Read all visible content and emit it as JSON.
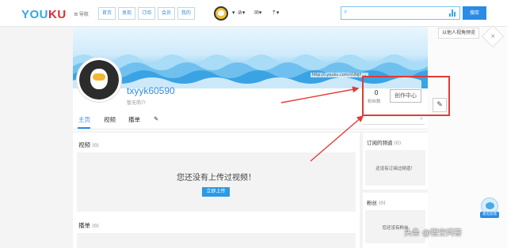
{
  "header": {
    "logo_a": "YOU",
    "logo_b": "KU",
    "menu_label": "导航",
    "tabs": [
      "首页",
      "发现",
      "订阅",
      "会员",
      "我的"
    ],
    "search_placeholder": "",
    "search_button": "搜库"
  },
  "banner": {
    "url_watermark": "http://i.youku.com/i/UNjY ...",
    "view_as_other": "以他人视角预览"
  },
  "profile": {
    "username": "txyyk60590",
    "bio": "暂无简介",
    "fans_count": "0",
    "fans_label": "粉丝数",
    "creator_center": "创作中心"
  },
  "tabs": {
    "home": "主页",
    "videos": "视频",
    "playlists": "播单"
  },
  "videos_section": {
    "title": "视频",
    "count": "(0)",
    "empty_text": "您还没有上传过视频！",
    "upload_button": "立即上传"
  },
  "playlists_section": {
    "title": "播单",
    "count": "(0)"
  },
  "subscriptions": {
    "title": "订阅的频道",
    "count": "(0)",
    "empty_text": "还没有订阅过频道！"
  },
  "fans": {
    "title": "粉丝",
    "count": "(0)",
    "empty_text": "您还没有粉丝"
  },
  "feedback_label": "意见反馈",
  "watermark": "头条 @悟空问答",
  "colors": {
    "brand_blue": "#2a8ce6",
    "logo_red": "#e02a33",
    "annotation_red": "#e53935"
  }
}
